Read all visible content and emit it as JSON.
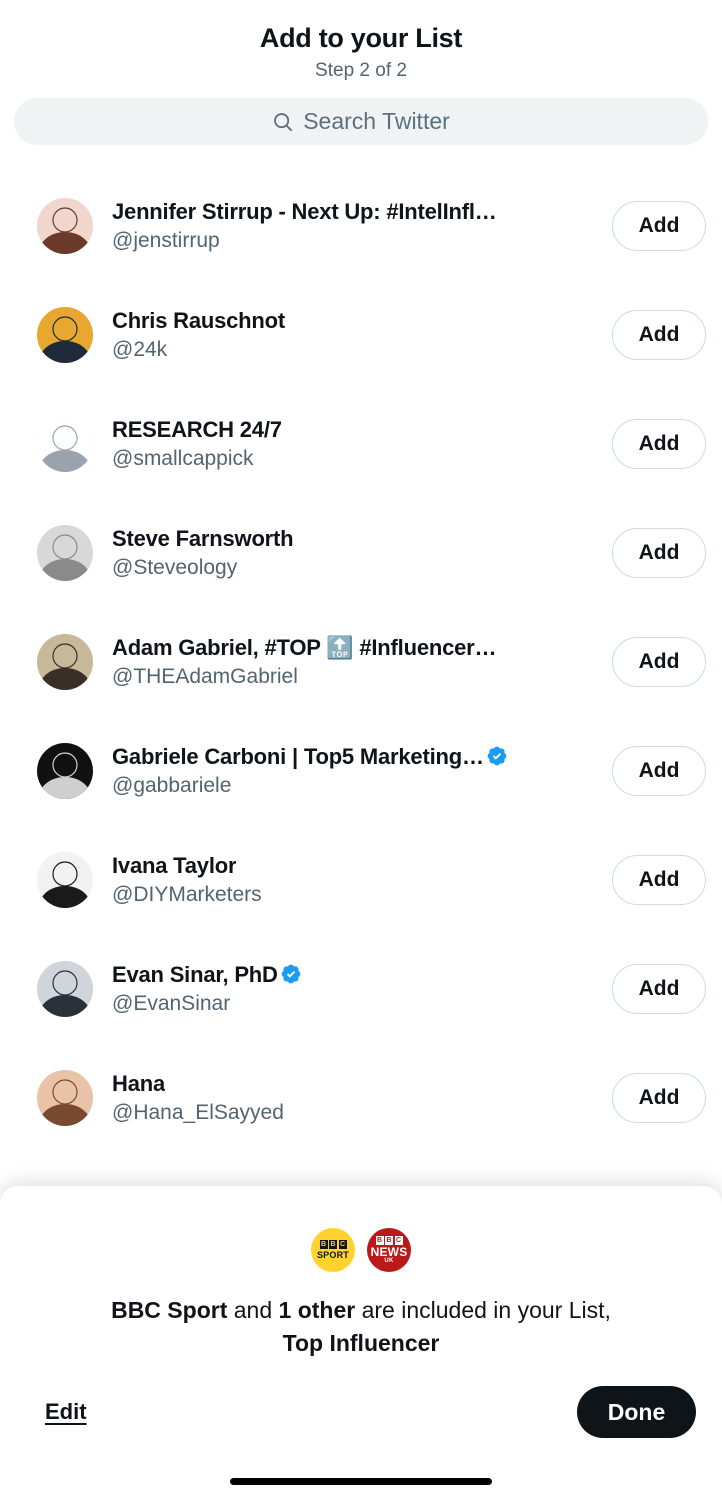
{
  "header": {
    "title": "Add to your List",
    "step": "Step 2 of 2"
  },
  "search": {
    "placeholder": "Search Twitter",
    "icon": "search-icon",
    "value": ""
  },
  "list": {
    "add_label": "Add",
    "users": [
      {
        "name": "Jennifer Stirrup - Next Up: #IntelInfl…",
        "handle": "@jenstirrup",
        "verified": false,
        "avatar_colors": [
          "#f0d6cd",
          "#6b3a2a"
        ]
      },
      {
        "name": "Chris Rauschnot",
        "handle": "@24k",
        "verified": false,
        "avatar_colors": [
          "#e8a830",
          "#1d2b3a"
        ]
      },
      {
        "name": "RESEARCH 24/7",
        "handle": "@smallcappick",
        "verified": false,
        "avatar_colors": [
          "#ffffff",
          "#9aa3ad"
        ]
      },
      {
        "name": "Steve Farnsworth",
        "handle": "@Steveology",
        "verified": false,
        "avatar_colors": [
          "#d8d8d8",
          "#8a8a8a"
        ]
      },
      {
        "name": "Adam Gabriel, #TOP 🔝 #Influencer…",
        "handle": "@THEAdamGabriel",
        "verified": false,
        "avatar_colors": [
          "#c8b89a",
          "#3a2f26"
        ]
      },
      {
        "name": "Gabriele Carboni | Top5 Marketing…",
        "handle": "@gabbariele",
        "verified": true,
        "avatar_colors": [
          "#111111",
          "#cfcfcf"
        ]
      },
      {
        "name": "Ivana Taylor",
        "handle": "@DIYMarketers",
        "verified": false,
        "avatar_colors": [
          "#f2f2f2",
          "#1a1a1a"
        ]
      },
      {
        "name": "Evan Sinar, PhD",
        "handle": "@EvanSinar",
        "verified": true,
        "avatar_colors": [
          "#cfd5da",
          "#2a3038"
        ]
      },
      {
        "name": "Hana",
        "handle": "@Hana_ElSayyed",
        "verified": false,
        "avatar_colors": [
          "#e8c3a8",
          "#7a4a30"
        ]
      }
    ]
  },
  "sheet": {
    "avatars": [
      {
        "name": "BBC Sport",
        "bbc": "BBC",
        "word": "SPORT",
        "sub": "",
        "bg": "#ffd230",
        "fg": "#151515"
      },
      {
        "name": "BBC News UK",
        "bbc": "BBC",
        "word": "NEWS",
        "sub": "UK",
        "bg": "#bb1919",
        "fg": "#ffffff"
      }
    ],
    "message_primary": "BBC Sport",
    "message_mid1": " and ",
    "message_count": "1 other",
    "message_mid2": " are included in your List,",
    "message_list_name": "Top Influencer",
    "edit_label": "Edit",
    "done_label": "Done"
  },
  "colors": {
    "accent_verified": "#1d9bf0",
    "text_primary": "#0f1419",
    "text_secondary": "#536471",
    "search_bg": "#eff3f4",
    "border": "#cfd9de",
    "button_dark": "#0f1419"
  }
}
